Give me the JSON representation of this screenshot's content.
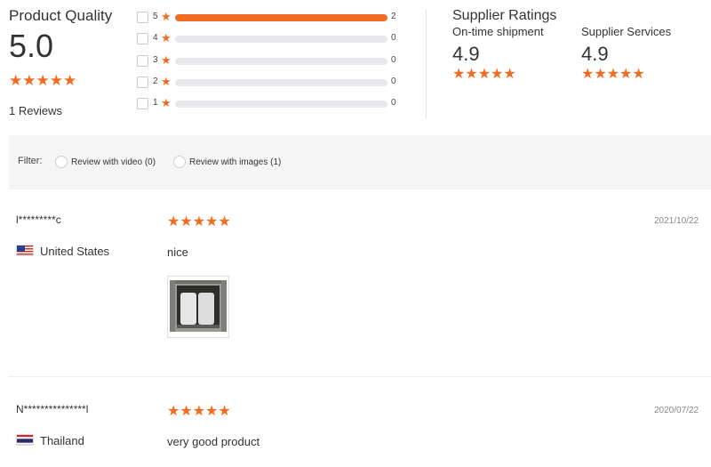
{
  "colors": {
    "accent": "#f26b21",
    "track": "#e8e8ec",
    "filter_bg": "#f5f5f5"
  },
  "product_quality": {
    "title": "Product Quality",
    "score": "5.0",
    "stars": "★★★★★",
    "reviews_label": "1 Reviews",
    "distribution": [
      {
        "stars": "5",
        "count": "2",
        "fraction": 1.0
      },
      {
        "stars": "4",
        "count": "0",
        "fraction": 0
      },
      {
        "stars": "3",
        "count": "0",
        "fraction": 0
      },
      {
        "stars": "2",
        "count": "0",
        "fraction": 0
      },
      {
        "stars": "1",
        "count": "0",
        "fraction": 0
      }
    ]
  },
  "supplier_ratings": {
    "title": "Supplier Ratings",
    "items": [
      {
        "label": "On-time shipment",
        "score": "4.9",
        "stars": "★★★★★"
      },
      {
        "label": "Supplier Services",
        "score": "4.9",
        "stars": "★★★★★"
      }
    ]
  },
  "filter": {
    "label": "Filter:",
    "options": [
      {
        "label": "Review with video (0)"
      },
      {
        "label": "Review with images (1)"
      }
    ]
  },
  "reviews": [
    {
      "user": "l*********c",
      "country": "United States",
      "flag_icon": "us-flag-icon",
      "stars": "★★★★★",
      "date": "2021/10/22",
      "text": "nice",
      "has_image": true
    },
    {
      "user": "N***************l",
      "country": "Thailand",
      "flag_icon": "thailand-flag-icon",
      "stars": "★★★★★",
      "date": "2020/07/22",
      "text": "very good product",
      "has_image": false
    }
  ]
}
